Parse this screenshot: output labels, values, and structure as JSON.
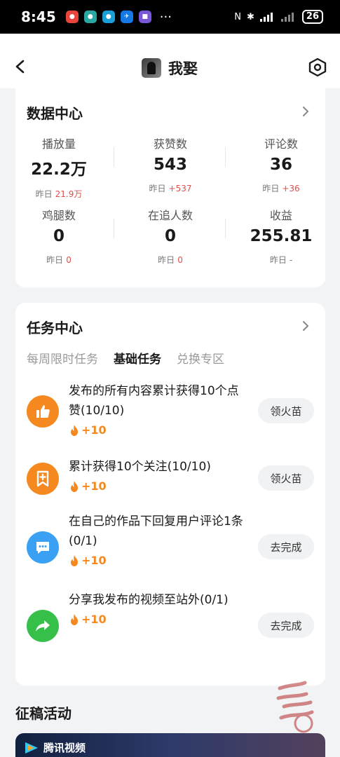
{
  "status_bar": {
    "time": "8:45",
    "battery": "26",
    "more": "···"
  },
  "header": {
    "title": "我娶"
  },
  "data_center": {
    "title": "数据中心",
    "yesterday_label": "昨日",
    "stats": [
      {
        "label": "播放量",
        "value": "22.2万",
        "yesterday": "21.9万"
      },
      {
        "label": "获赞数",
        "value": "543",
        "yesterday": "+537"
      },
      {
        "label": "评论数",
        "value": "36",
        "yesterday": "+36"
      },
      {
        "label": "鸡腿数",
        "value": "0",
        "yesterday": "0"
      },
      {
        "label": "在追人数",
        "value": "0",
        "yesterday": "0"
      },
      {
        "label": "收益",
        "value": "255.81",
        "yesterday": "-"
      }
    ]
  },
  "task_center": {
    "title": "任务中心",
    "tabs": [
      "每周限时任务",
      "基础任务",
      "兑换专区"
    ],
    "active_tab": "基础任务",
    "tasks": [
      {
        "text": "发布的所有内容累计获得10个点赞(10/10)",
        "reward": "+10",
        "button": "领火苗",
        "icon": "thumbs-up-icon",
        "color": "#f5891f"
      },
      {
        "text": "累计获得10个关注(10/10)",
        "reward": "+10",
        "button": "领火苗",
        "icon": "bookmark-plus-icon",
        "color": "#f5891f"
      },
      {
        "text": "在自己的作品下回复用户评论1条(0/1)",
        "reward": "+10",
        "button": "去完成",
        "icon": "comment-icon",
        "color": "#3aa0f3"
      },
      {
        "text": "分享我发布的视频至站外(0/1)",
        "reward": "+10",
        "button": "去完成",
        "icon": "share-icon",
        "color": "#36c04a"
      }
    ]
  },
  "activity": {
    "title": "征稿活动",
    "banner_logo": "腾讯视频"
  }
}
